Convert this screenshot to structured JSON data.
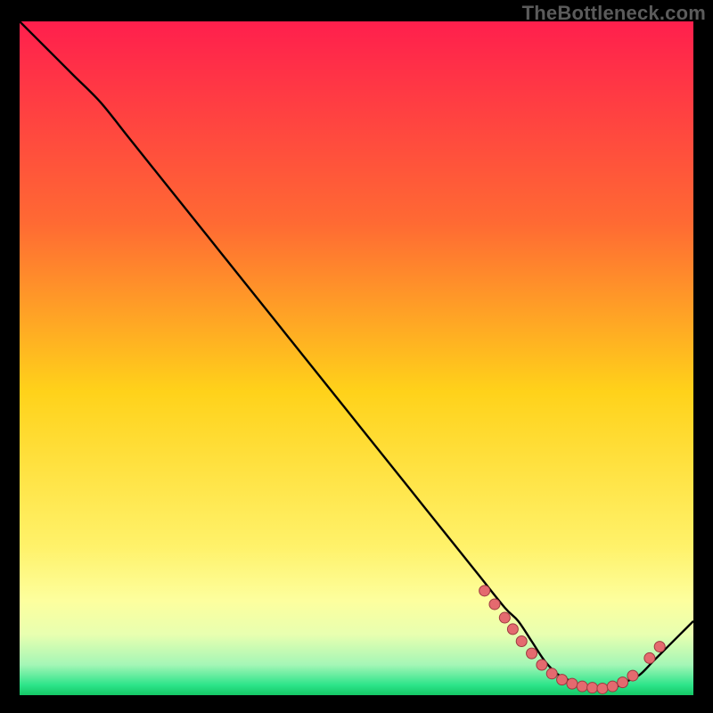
{
  "watermark": "TheBottleneck.com",
  "chart_data": {
    "type": "line",
    "title": "",
    "xlabel": "",
    "ylabel": "",
    "xlim": [
      0,
      100
    ],
    "ylim": [
      0,
      100
    ],
    "grid": false,
    "background_gradient": {
      "stops": [
        {
          "offset": 0.0,
          "color": "#ff1f4d"
        },
        {
          "offset": 0.3,
          "color": "#ff6a33"
        },
        {
          "offset": 0.55,
          "color": "#ffd21a"
        },
        {
          "offset": 0.78,
          "color": "#fff26a"
        },
        {
          "offset": 0.86,
          "color": "#fdff9e"
        },
        {
          "offset": 0.91,
          "color": "#e8ffb0"
        },
        {
          "offset": 0.955,
          "color": "#a4f6b6"
        },
        {
          "offset": 0.985,
          "color": "#2de48a"
        },
        {
          "offset": 1.0,
          "color": "#14c765"
        }
      ]
    },
    "series": [
      {
        "name": "bottleneck-curve",
        "color": "#000000",
        "x": [
          0,
          4,
          8,
          12,
          16,
          20,
          24,
          28,
          32,
          36,
          40,
          44,
          48,
          52,
          56,
          60,
          64,
          68,
          72,
          74,
          76,
          78,
          80,
          82,
          84,
          86,
          88,
          90,
          92,
          94,
          96,
          98,
          100
        ],
        "y": [
          100,
          96,
          92,
          88,
          83,
          78,
          73,
          68,
          63,
          58,
          53,
          48,
          43,
          38,
          33,
          28,
          23,
          18,
          13,
          11,
          8,
          5,
          3,
          2,
          1,
          1,
          1,
          2,
          3,
          5,
          7,
          9,
          11
        ]
      }
    ],
    "markers": [
      {
        "x": 69.0,
        "y": 15.5
      },
      {
        "x": 70.5,
        "y": 13.5
      },
      {
        "x": 72.0,
        "y": 11.5
      },
      {
        "x": 73.2,
        "y": 9.8
      },
      {
        "x": 74.5,
        "y": 8.0
      },
      {
        "x": 76.0,
        "y": 6.2
      },
      {
        "x": 77.5,
        "y": 4.5
      },
      {
        "x": 79.0,
        "y": 3.2
      },
      {
        "x": 80.5,
        "y": 2.3
      },
      {
        "x": 82.0,
        "y": 1.7
      },
      {
        "x": 83.5,
        "y": 1.3
      },
      {
        "x": 85.0,
        "y": 1.1
      },
      {
        "x": 86.5,
        "y": 1.0
      },
      {
        "x": 88.0,
        "y": 1.3
      },
      {
        "x": 89.5,
        "y": 1.9
      },
      {
        "x": 91.0,
        "y": 2.9
      },
      {
        "x": 93.5,
        "y": 5.5
      },
      {
        "x": 95.0,
        "y": 7.2
      }
    ],
    "marker_style": {
      "fill": "#e46a6f",
      "stroke": "#9c3a40",
      "r": 6
    }
  }
}
